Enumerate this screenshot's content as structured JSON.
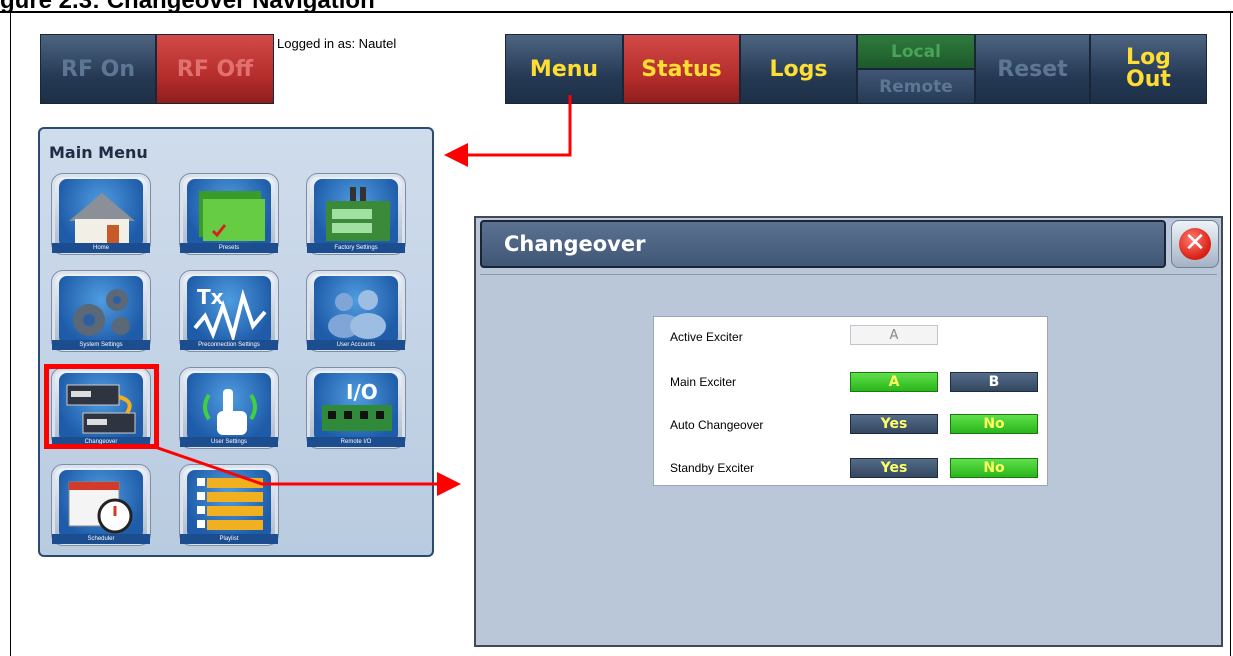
{
  "doc_heading": "gure 2.3: Changeover Navigation",
  "toolbar": {
    "rf_on": "RF On",
    "rf_off": "RF Off",
    "logged_in": "Logged in as: Nautel",
    "menu": "Menu",
    "status": "Status",
    "logs": "Logs",
    "local": "Local",
    "remote": "Remote",
    "reset": "Reset",
    "logout": "Log Out"
  },
  "main_menu": {
    "title": "Main Menu",
    "items": [
      {
        "caption": "Home",
        "icon": "home-icon"
      },
      {
        "caption": "Presets",
        "icon": "folder-icon"
      },
      {
        "caption": "Factory Settings",
        "icon": "factory-icon"
      },
      {
        "caption": "System Settings",
        "icon": "gears-icon"
      },
      {
        "caption": "Preconnection Settings",
        "icon": "waveform-icon"
      },
      {
        "caption": "User Accounts",
        "icon": "users-icon"
      },
      {
        "caption": "Changeover",
        "icon": "changeover-icon"
      },
      {
        "caption": "User Settings",
        "icon": "touch-icon"
      },
      {
        "caption": "Remote I/O",
        "icon": "io-board-icon"
      },
      {
        "caption": "Scheduler",
        "icon": "calendar-clock-icon"
      },
      {
        "caption": "Playlist",
        "icon": "playlist-icon"
      }
    ]
  },
  "changeover": {
    "title": "Changeover",
    "active_exciter_label": "Active Exciter",
    "active_exciter_value": "A",
    "main_exciter_label": "Main Exciter",
    "main_exciter_a": "A",
    "main_exciter_b": "B",
    "auto_changeover_label": "Auto Changeover",
    "auto_changeover_yes": "Yes",
    "auto_changeover_no": "No",
    "standby_exciter_label": "Standby Exciter",
    "standby_exciter_yes": "Yes",
    "standby_exciter_no": "No"
  },
  "colors": {
    "selected_green": "#29b51b",
    "unselected_blue": "#33475f",
    "callout_red": "#ff0000"
  }
}
